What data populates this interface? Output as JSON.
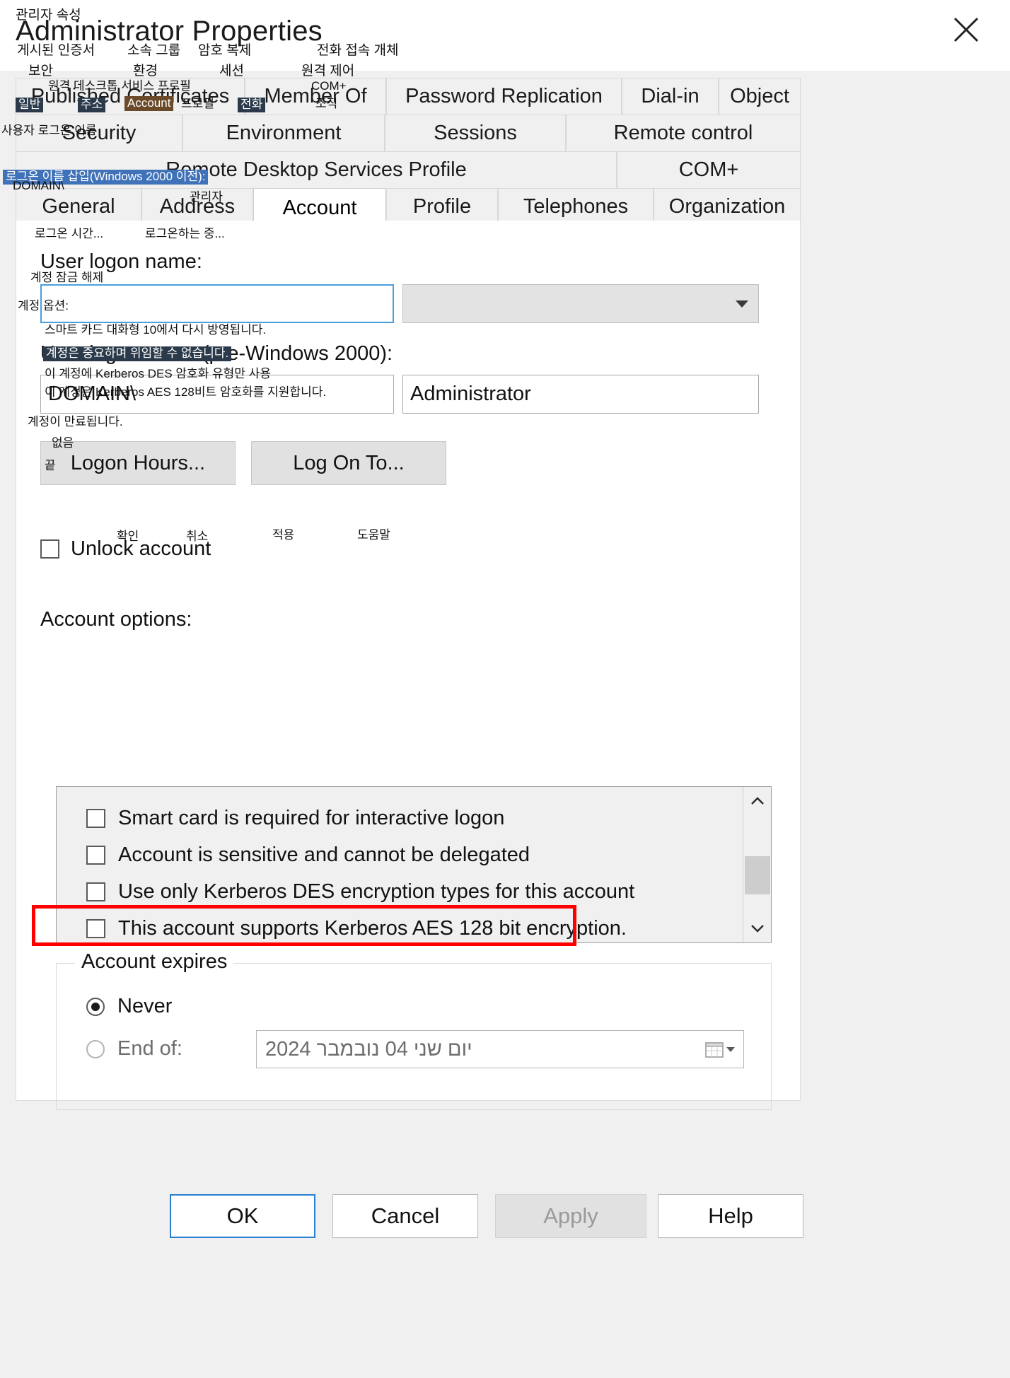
{
  "window": {
    "title_ko": "관리자 속성",
    "title_en": "Administrator Properties",
    "close_icon": "close-icon"
  },
  "tabs": {
    "row1": [
      {
        "label": "Published Certificates",
        "selected": false
      },
      {
        "label": "Member Of",
        "selected": false
      },
      {
        "label": "Password Replication",
        "selected": false
      },
      {
        "label": "Dial-in",
        "selected": false
      },
      {
        "label": "Object",
        "selected": false
      }
    ],
    "row2": [
      {
        "label": "Security",
        "selected": false
      },
      {
        "label": "Environment",
        "selected": false
      },
      {
        "label": "Sessions",
        "selected": false
      },
      {
        "label": "Remote control",
        "selected": false
      }
    ],
    "row3": [
      {
        "label": "Remote Desktop Services Profile",
        "selected": false
      },
      {
        "label": "COM+",
        "selected": false
      }
    ],
    "row4": [
      {
        "label": "General",
        "selected": false
      },
      {
        "label": "Address",
        "selected": false
      },
      {
        "label": "Account",
        "selected": true
      },
      {
        "label": "Profile",
        "selected": false
      },
      {
        "label": "Telephones",
        "selected": false
      },
      {
        "label": "Organization",
        "selected": false
      }
    ]
  },
  "account": {
    "user_logon_name_label": "User logon name:",
    "user_logon_name_value": "",
    "upn_suffix_value": "",
    "pre2000_label_suffix": "Windows 2000):",
    "domain_value": "DOMAIN\\",
    "sam_account_value": "Administrator",
    "logon_hours_button": "Logon Hours...",
    "log_on_to_button": "Log On To...",
    "unlock_account_label": "Unlock account",
    "unlock_account_checked": false,
    "account_options_label": "Account options:",
    "options": [
      {
        "label": "Smart card is required for interactive logon",
        "checked": false,
        "highlighted": false
      },
      {
        "label": "Account is sensitive and cannot be delegated",
        "checked": false,
        "highlighted": true
      },
      {
        "label": "Use only Kerberos DES encryption types for this account",
        "checked": false,
        "highlighted": false
      },
      {
        "label": "This account supports Kerberos AES 128 bit encryption.",
        "checked": false,
        "highlighted": false
      }
    ],
    "expires": {
      "legend": "Account expires",
      "never_label": "Never",
      "never_selected": true,
      "end_of_label": "End of:",
      "end_of_selected": false,
      "end_of_date": "יום שני  04  נובמבר  2024",
      "calendar_icon": "calendar-icon"
    }
  },
  "footer": {
    "ok": "OK",
    "cancel": "Cancel",
    "apply": "Apply",
    "help": "Help",
    "apply_disabled": true
  },
  "korean_overlay": {
    "published_certificates": "게시된 인증서",
    "member_of": "소속 그룹",
    "password_replication": "암호 복제",
    "dial_in_object": "전화 접속 개체",
    "security": "보안",
    "environment": "환경",
    "sessions": "세션",
    "remote_control": "원격 제어",
    "rds_profile": "원격 데스크톱 서비스 프로필",
    "com_plus": "COM+",
    "general": "일반",
    "address": "주소",
    "account": "Account",
    "profile": "프로필",
    "telephones": "전화",
    "organization": "조직",
    "user_logon_name": "사용자 로그온 이름",
    "pre2000_logon": "로그온 이름 삽입(Windows  2000 이전):",
    "administrator": "관리자",
    "logon_hours": "로그온 시간...",
    "log_on_to": "로그온하는 중...",
    "unlock_account": "계정 잠금 해제",
    "account_options": "계정 옵션:",
    "smart_card": "스마트 카드 대화형 10에서 다시 방영됩니다.",
    "sensitive": "계정은 중요하며 위임할 수 없습니다.",
    "kerberos_des": "이 계정에 Kerberos  DES 암호화 유형만 사용",
    "kerberos_aes": "이 계정은 Kerberos  AES 128비트 암호화를 지원합니다.",
    "account_expires": "계정이 만료됩니다.",
    "never": "없음",
    "end_of": "끝",
    "ok": "확인",
    "cancel": "취소",
    "apply": "적용",
    "help": "도움말"
  },
  "colors": {
    "accent": "#2a7fd0",
    "highlight": "#ff0000",
    "overlay_dark": "#2b3a4a",
    "overlay_brown": "#6b4a2a",
    "overlay_blue": "#3f72b8"
  }
}
